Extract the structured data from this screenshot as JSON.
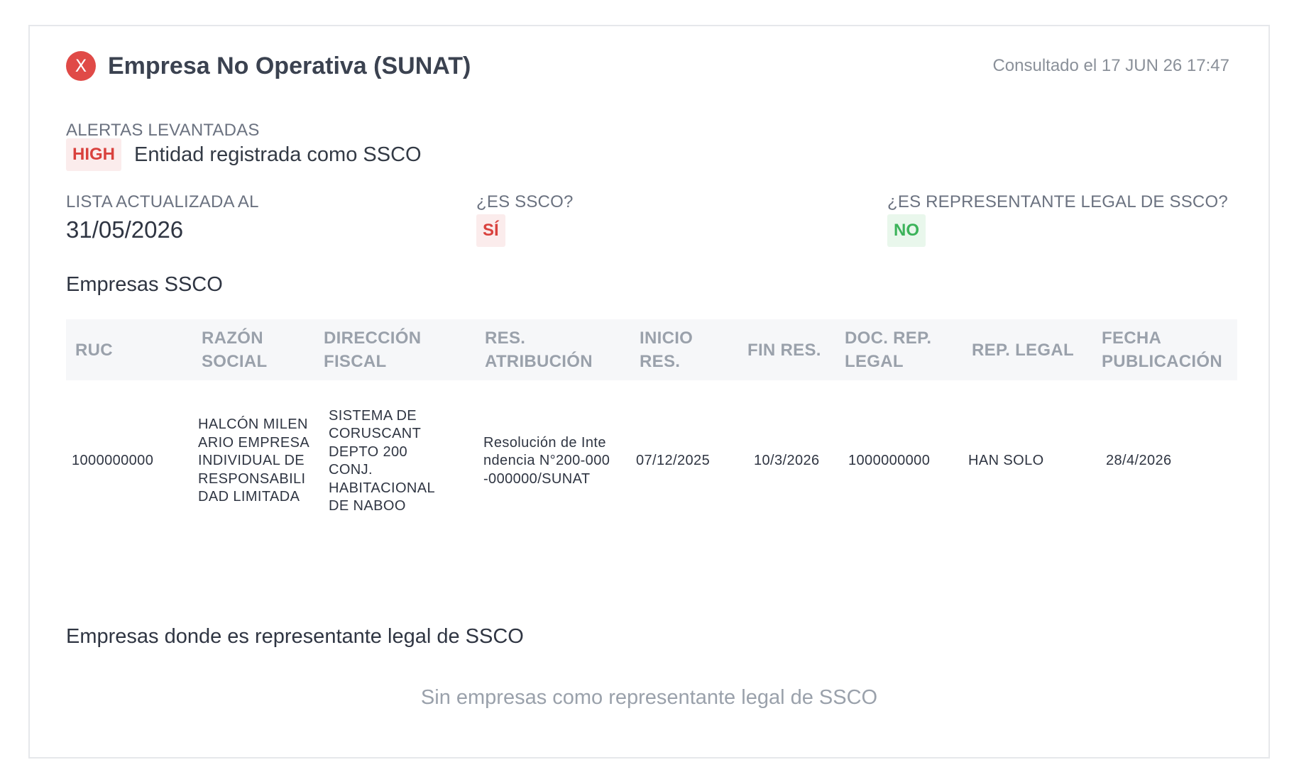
{
  "header": {
    "status_icon": "x-circle-icon",
    "status_icon_glyph": "X",
    "title": "Empresa No Operativa (SUNAT)",
    "consulted": "Consultado el 17 JUN 26 17:47"
  },
  "alerts": {
    "label": "ALERTAS LEVANTADAS",
    "items": [
      {
        "severity": "HIGH",
        "text": "Entidad registrada como SSCO"
      }
    ]
  },
  "summary": {
    "list_updated_label": "LISTA ACTUALIZADA AL",
    "list_updated_value": "31/05/2026",
    "is_ssco_label": "¿ES SSCO?",
    "is_ssco_value": "SÍ",
    "is_rep_label": "¿ES REPRESENTANTE LEGAL DE SSCO?",
    "is_rep_value": "NO"
  },
  "ssco_companies": {
    "title": "Empresas SSCO",
    "columns": [
      "RUC",
      "RAZÓN SOCIAL",
      "DIRECCIÓN FISCAL",
      "RES. ATRIBUCIÓN",
      "INICIO RES.",
      "FIN RES.",
      "DOC. REP. LEGAL",
      "REP. LEGAL",
      "FECHA PUBLICACIÓN"
    ],
    "rows": [
      [
        "1000000000",
        "HALCÓN MILENARIO EMPRESA INDIVIDUAL DE RESPONSABILIDAD LIMITADA",
        "SISTEMA DE CORUSCANT DEPTO 200 CONJ. HABITACIONAL DE NABOO",
        "Resolución de Intendencia N°200-000-000000/SUNAT",
        "07/12/2025",
        "10/3/2026",
        "1000000000",
        "HAN SOLO",
        "28/4/2026"
      ]
    ]
  },
  "rep_companies": {
    "title": "Empresas donde es representante legal de SSCO",
    "empty_message": "Sin empresas como representante legal de SSCO"
  },
  "colors": {
    "danger": "#e04a47",
    "success": "#3cb35a"
  }
}
